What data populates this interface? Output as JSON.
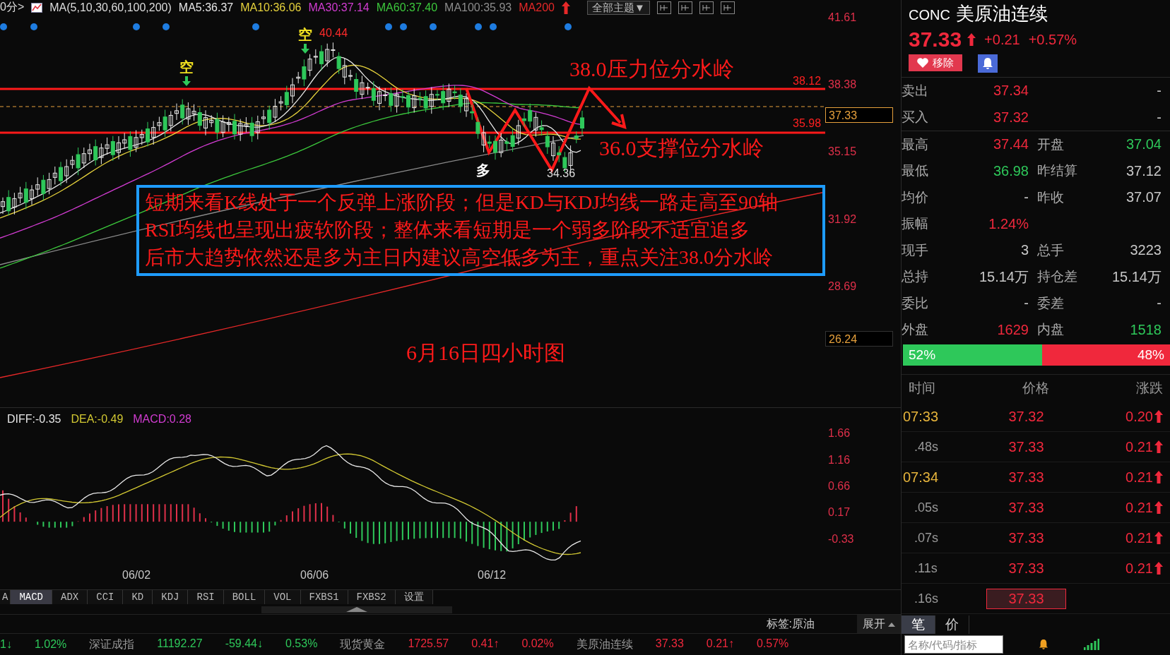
{
  "toolbar": {
    "period": "0分>",
    "indicator": "MA(5,10,30,60,100,200)",
    "averages": [
      {
        "label": "MA5:36.37",
        "color": "#e6e6e6"
      },
      {
        "label": "MA10:36.06",
        "color": "#e6d23c"
      },
      {
        "label": "MA30:37.14",
        "color": "#d23cd2"
      },
      {
        "label": "MA60:37.40",
        "color": "#3cc83c"
      },
      {
        "label": "MA100:35.93",
        "color": "#8c8c8c"
      },
      {
        "label": "MA200",
        "color": "#e62828"
      }
    ],
    "theme_button": "全部主题▼"
  },
  "price_chart": {
    "y_axis": [
      "41.61",
      "38.38",
      "35.15",
      "31.92",
      "28.69"
    ],
    "current_price": "37.33",
    "last_marker": "26.24",
    "resistance": {
      "value": "38.12",
      "label": "38.0压力位分水岭"
    },
    "support": {
      "value": "35.98",
      "label": "36.0支撑位分水岭"
    },
    "markers": [
      {
        "kind": "short",
        "label": "空"
      },
      {
        "kind": "short",
        "label": "空"
      },
      {
        "kind": "long",
        "label": "多"
      }
    ],
    "high_label": "40.44",
    "low_label": "34.36",
    "note": [
      "短期来看K线处于一个反弹上涨阶段；但是KD与KDJ均线一路走高至90轴",
      "RSI均线也呈现出疲软阶段；整体来看短期是一个弱多阶段不适宜追多",
      "后市大趋势依然还是多为主日内建议高空低多为主，重点关注38.0分水岭"
    ],
    "caption": "6月16日四小时图"
  },
  "macd": {
    "readouts": [
      {
        "label": "DIFF:-0.35",
        "color": "#e6e6e6"
      },
      {
        "label": "DEA:-0.49",
        "color": "#d2c832"
      },
      {
        "label": "MACD:0.28",
        "color": "#d23cd2"
      }
    ],
    "y_axis": [
      "1.66",
      "1.16",
      "0.66",
      "0.17",
      "-0.33"
    ],
    "x_axis": [
      "06/02",
      "06/06",
      "06/12"
    ]
  },
  "indicator_tabs": [
    {
      "label": "A",
      "selected": false
    },
    {
      "label": "MACD",
      "selected": true
    },
    {
      "label": "ADX",
      "selected": false
    },
    {
      "label": "CCI",
      "selected": false
    },
    {
      "label": "KD",
      "selected": false
    },
    {
      "label": "KDJ",
      "selected": false
    },
    {
      "label": "RSI",
      "selected": false
    },
    {
      "label": "BOLL",
      "selected": false
    },
    {
      "label": "VOL",
      "selected": false
    },
    {
      "label": "FXBS1",
      "selected": false
    },
    {
      "label": "FXBS2",
      "selected": false
    },
    {
      "label": "设置",
      "selected": false
    }
  ],
  "tag_label": "标签:原油",
  "expand_button": "展开",
  "ticker": [
    {
      "change": "1↓",
      "percent": "1.02%",
      "color": "#2ec85a"
    },
    {
      "name": "深证成指",
      "value": "11192.27",
      "change": "-59.44↓",
      "percent": "0.53%",
      "color": "#2ec85a"
    },
    {
      "name": "现货黄金",
      "value": "1725.57",
      "change": "0.41↑",
      "percent": "0.02%",
      "color": "#f0283c"
    },
    {
      "name": "美原油连续",
      "value": "37.33",
      "change": "0.21↑",
      "percent": "0.57%",
      "color": "#f0283c"
    }
  ],
  "quote": {
    "code": "CONC",
    "name": "美原油连续",
    "price": "37.33",
    "change": "+0.21",
    "percent": "+0.57%",
    "remove_button": "移除"
  },
  "order_book": [
    {
      "cells": [
        {
          "label": "卖出",
          "value": "37.34",
          "color": "#f0283c"
        },
        {
          "value": "-",
          "color": "#c8c8c8"
        }
      ]
    },
    {
      "cells": [
        {
          "label": "买入",
          "value": "37.32",
          "color": "#f0283c"
        },
        {
          "value": "-",
          "color": "#c8c8c8"
        }
      ]
    }
  ],
  "stats": [
    {
      "cells": [
        {
          "label": "最高",
          "value": "37.44",
          "color": "#f0283c"
        },
        {
          "label": "开盘",
          "value": "37.04",
          "color": "#2ec85a"
        }
      ]
    },
    {
      "cells": [
        {
          "label": "最低",
          "value": "36.98",
          "color": "#2ec85a"
        },
        {
          "label": "昨结算",
          "value": "37.12",
          "color": "#c8c8c8"
        }
      ]
    },
    {
      "cells": [
        {
          "label": "均价",
          "value": "-",
          "color": "#c8c8c8"
        },
        {
          "label": "昨收",
          "value": "37.07",
          "color": "#c8c8c8"
        }
      ]
    },
    {
      "cells": [
        {
          "label": "振幅",
          "value": "1.24%",
          "color": "#f0283c"
        }
      ]
    },
    {
      "cells": [
        {
          "label": "现手",
          "value": "3",
          "color": "#c8c8c8"
        },
        {
          "label": "总手",
          "value": "3223",
          "color": "#c8c8c8"
        }
      ]
    },
    {
      "cells": [
        {
          "label": "总持",
          "value": "15.14万",
          "color": "#c8c8c8"
        },
        {
          "label": "持仓差",
          "value": "15.14万",
          "color": "#c8c8c8"
        }
      ]
    },
    {
      "cells": [
        {
          "label": "委比",
          "value": "-",
          "color": "#c8c8c8"
        },
        {
          "label": "委差",
          "value": "-",
          "color": "#c8c8c8"
        }
      ]
    },
    {
      "cells": [
        {
          "label": "外盘",
          "value": "1629",
          "color": "#f0283c"
        },
        {
          "label": "内盘",
          "value": "1518",
          "color": "#2ec85a"
        }
      ]
    }
  ],
  "ratio": {
    "buy": "52%",
    "sell": "48%",
    "level": 0.52
  },
  "trades": {
    "columns": [
      "时间",
      "价格",
      "涨跌"
    ],
    "rows": [
      {
        "time": "07:33",
        "kind": "minute",
        "price": "37.32",
        "change": "0.20",
        "selected": false
      },
      {
        "time": ".48s",
        "kind": "second",
        "price": "37.33",
        "change": "0.21",
        "selected": false
      },
      {
        "time": "07:34",
        "kind": "minute",
        "price": "37.33",
        "change": "0.21",
        "selected": false
      },
      {
        "time": ".05s",
        "kind": "second",
        "price": "37.33",
        "change": "0.21",
        "selected": false
      },
      {
        "time": ".07s",
        "kind": "second",
        "price": "37.33",
        "change": "0.21",
        "selected": false
      },
      {
        "time": ".11s",
        "kind": "second",
        "price": "37.33",
        "change": "0.21",
        "selected": false
      },
      {
        "time": ".16s",
        "kind": "second",
        "price": "37.33",
        "selected": true
      }
    ]
  },
  "bottom_tabs": [
    {
      "label": "笔",
      "selected": true
    },
    {
      "label": "价",
      "selected": false
    }
  ],
  "search": {
    "placeholder": "名称/代码/指标"
  }
}
